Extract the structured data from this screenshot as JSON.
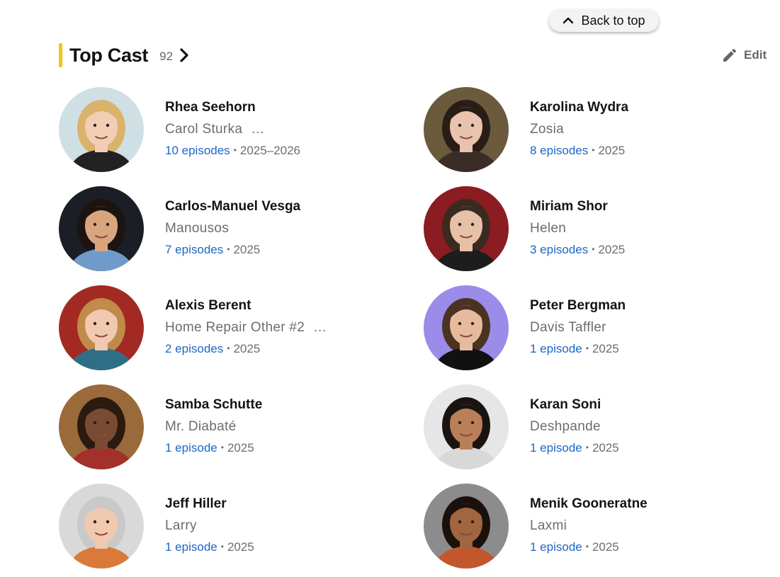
{
  "back_to_top": {
    "label": "Back to top"
  },
  "header": {
    "title": "Top Cast",
    "count": "92",
    "edit_label": "Edit"
  },
  "colors": {
    "accent": "#f5c518",
    "link": "#1a67c8"
  },
  "cast": [
    {
      "name": "Rhea Seehorn",
      "role": "Carol Sturka",
      "more": "…",
      "episodes": "10 episodes",
      "years": "2025–2026",
      "avatar": {
        "bg": "#cfe0e4",
        "skin": "#f1cdb6",
        "hair": "#d9b36b",
        "cloth": "#222222"
      }
    },
    {
      "name": "Karolina Wydra",
      "role": "Zosia",
      "more": "",
      "episodes": "8 episodes",
      "years": "2025",
      "avatar": {
        "bg": "#6b5a3c",
        "skin": "#e8c3ae",
        "hair": "#2a1d16",
        "cloth": "#3a2d25"
      }
    },
    {
      "name": "Carlos-Manuel Vesga",
      "role": "Manousos",
      "more": "",
      "episodes": "7 episodes",
      "years": "2025",
      "avatar": {
        "bg": "#1b1e24",
        "skin": "#d9a57f",
        "hair": "#1c1410",
        "cloth": "#6e9bc9"
      }
    },
    {
      "name": "Miriam Shor",
      "role": "Helen",
      "more": "",
      "episodes": "3 episodes",
      "years": "2025",
      "avatar": {
        "bg": "#8a1c22",
        "skin": "#e7c0a8",
        "hair": "#3b2a20",
        "cloth": "#1d1d1d"
      }
    },
    {
      "name": "Alexis Berent",
      "role": "Home Repair Other #2",
      "more": "…",
      "episodes": "2 episodes",
      "years": "2025",
      "avatar": {
        "bg": "#a32a22",
        "skin": "#f0c9b0",
        "hair": "#c08a4a",
        "cloth": "#2f6f86"
      }
    },
    {
      "name": "Peter Bergman",
      "role": "Davis Taffler",
      "more": "",
      "episodes": "1 episode",
      "years": "2025",
      "avatar": {
        "bg": "#9a8ce8",
        "skin": "#e6bb9d",
        "hair": "#4a3320",
        "cloth": "#111111"
      }
    },
    {
      "name": "Samba Schutte",
      "role": "Mr. Diabaté",
      "more": "",
      "episodes": "1 episode",
      "years": "2025",
      "avatar": {
        "bg": "#9a6a3a",
        "skin": "#7a4a32",
        "hair": "#2b1a10",
        "cloth": "#a3302a"
      }
    },
    {
      "name": "Karan Soni",
      "role": "Deshpande",
      "more": "",
      "episodes": "1 episode",
      "years": "2025",
      "avatar": {
        "bg": "#e6e6e6",
        "skin": "#b87f59",
        "hair": "#1a1411",
        "cloth": "#d8d8d8"
      }
    },
    {
      "name": "Jeff Hiller",
      "role": "Larry",
      "more": "",
      "episodes": "1 episode",
      "years": "2025",
      "avatar": {
        "bg": "#d9d9d9",
        "skin": "#f0c9b0",
        "hair": "#c9c9c9",
        "cloth": "#d97a3a"
      }
    },
    {
      "name": "Menik Gooneratne",
      "role": "Laxmi",
      "more": "",
      "episodes": "1 episode",
      "years": "2025",
      "avatar": {
        "bg": "#8c8c8c",
        "skin": "#a0663f",
        "hair": "#1a100c",
        "cloth": "#c2572d"
      }
    }
  ]
}
